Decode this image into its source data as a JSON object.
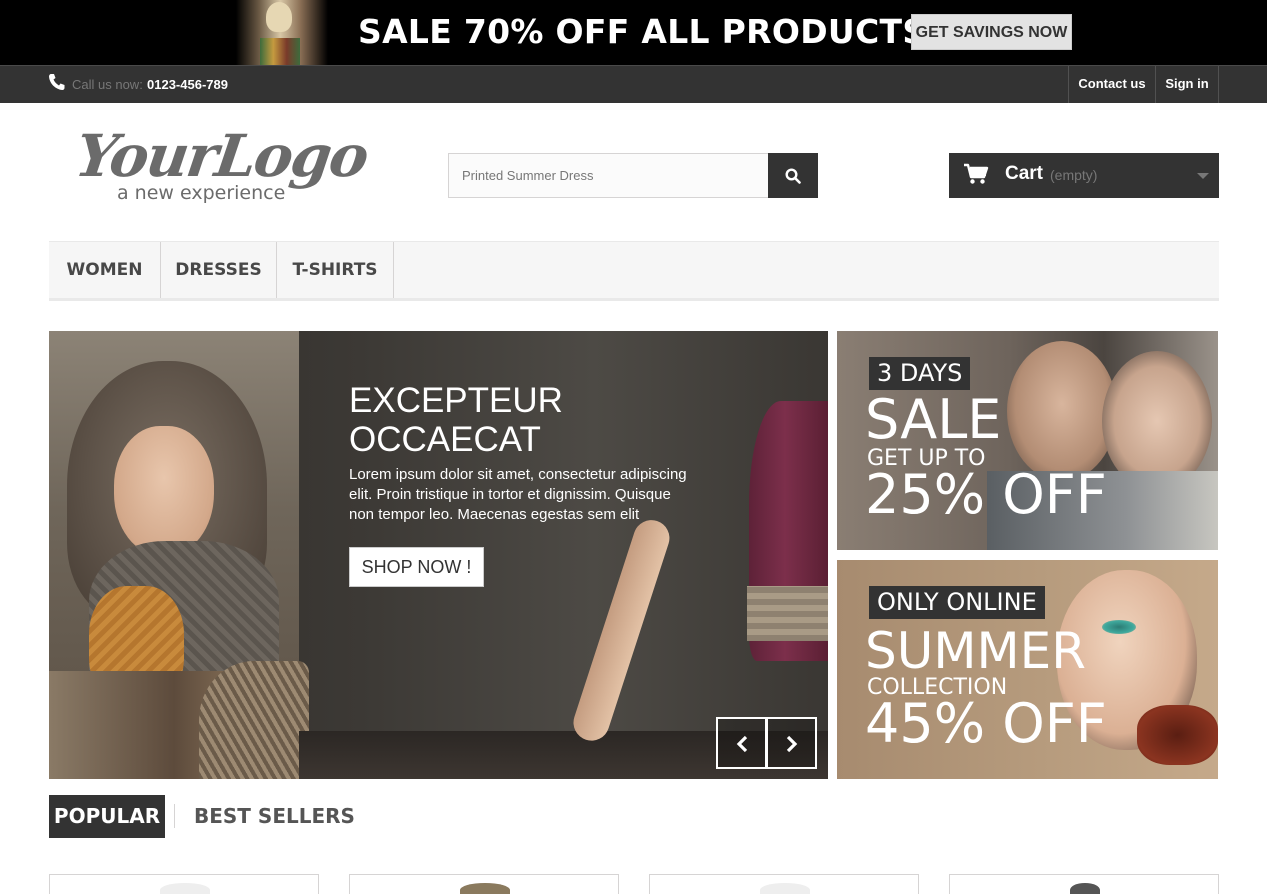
{
  "promo_banner": {
    "headline": "SALE 70% OFF ALL PRODUCTS",
    "button_label": "GET SAVINGS NOW"
  },
  "top_nav": {
    "call_label": "Call us now:",
    "phone_number": "0123-456-789",
    "contact_label": "Contact us",
    "signin_label": "Sign in"
  },
  "logo": {
    "main": "YourLogo",
    "tagline": "a new experience"
  },
  "search": {
    "value": "Printed Summer Dress",
    "icon": "search-icon"
  },
  "cart": {
    "label": "Cart",
    "status": "(empty)"
  },
  "menu": {
    "items": [
      "WOMEN",
      "DRESSES",
      "T-SHIRTS"
    ]
  },
  "slider": {
    "title": "EXCEPTEUR OCCAECAT",
    "text": "Lorem ipsum dolor sit amet, consectetur adipiscing elit. Proin tristique in tortor et dignissim. Quisque non tempor leo. Maecenas egestas sem elit",
    "button_label": "SHOP NOW !"
  },
  "tiles": [
    {
      "badge": "3 DAYS",
      "line1": "SALE",
      "line2": "GET UP TO",
      "line3": "25% OFF"
    },
    {
      "badge": "ONLY ONLINE",
      "line1": "SUMMER",
      "line2": "COLLECTION",
      "line3": "45% OFF"
    }
  ],
  "tabs": {
    "popular": "POPULAR",
    "best_sellers": "BEST SELLERS"
  },
  "colors": {
    "dark": "#333333",
    "promo_background": "#000000",
    "menu_background": "#f6f6f6"
  }
}
